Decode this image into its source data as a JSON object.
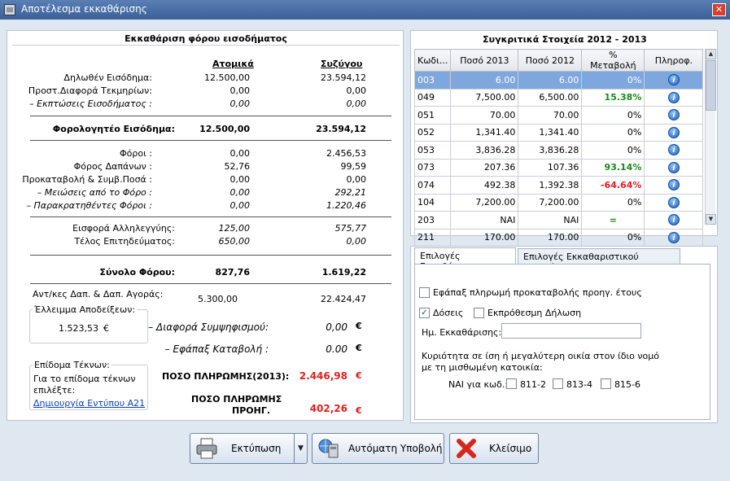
{
  "window": {
    "title": "Αποτέλεσμα εκκαθάρισης"
  },
  "left": {
    "title": "Εκκαθάριση φόρου εισοδήματος",
    "col_individual": "Ατομικά",
    "col_spouse": "Συζύγου",
    "rows": [
      {
        "label": "Δηλωθέν Εισόδημα:",
        "a": "12.500,00",
        "s": "23.594,12"
      },
      {
        "label": "Προστ.Διαφορά Τεκμηρίων:",
        "a": "0,00",
        "s": "0,00"
      },
      {
        "label": "– Εκπτώσεις Εισοδήματος  :",
        "a": "0,00",
        "s": "0,00"
      },
      {
        "label": "Φορολογητέο Εισόδημα:",
        "a": "12.500,00",
        "s": "23.594,12"
      },
      {
        "label": "Φόροι :",
        "a": "0,00",
        "s": "2.456,53"
      },
      {
        "label": "Φόρος Δαπάνων :",
        "a": "52,76",
        "s": "99,59"
      },
      {
        "label": "Προκαταβολή & Συμβ.Ποσά :",
        "a": "0,00",
        "s": "0,00"
      },
      {
        "label": "– Μειώσεις από το Φόρο :",
        "a": "0,00",
        "s": "292,21"
      },
      {
        "label": "– Παρακρατηθέντες Φόροι :",
        "a": "0,00",
        "s": "1.220,46"
      },
      {
        "label": "Εισφορά Αλληλεγγύης:",
        "a": "125,00",
        "s": "575,77"
      },
      {
        "label": "Τέλος Επιτηδεύματος:",
        "a": "650,00",
        "s": "0,00"
      },
      {
        "label": "Σύνολο Φόρου:",
        "a": "827,76",
        "s": "1.619,22"
      },
      {
        "label": "Αντ/κες Δαπ. & Δαπ. Αγοράς:",
        "a": "5.300,00",
        "s": "22.424,47"
      }
    ],
    "receipts_deficit": {
      "label": "Έλλειμμα Αποδείξεων:",
      "value": "1.523,53",
      "currency": "€"
    },
    "offset_diff": {
      "label": "– Διαφορά Συμψηφισμού:",
      "value": "0,00",
      "currency": "€"
    },
    "lump_sum": {
      "label": "– Εφάπαξ Καταβολή :",
      "value": "0.00",
      "currency": "€"
    },
    "payment_2013": {
      "label": "ΠΟΣΟ ΠΛΗΡΩΜΗΣ(2013):",
      "value": "2.446,98",
      "currency": "€"
    },
    "payment_prev": {
      "label_1": "ΠΟΣΟ ΠΛΗΡΩΜΗΣ",
      "label_2": "ΠΡΟΗΓ.",
      "value": "402,26",
      "currency": "€"
    },
    "child_benefit": {
      "legend": "Επίδομα Τέκνων:",
      "text_1": "Για το επίδομα τέκνων",
      "text_2": "επιλέξτε:",
      "link": "Δημιουργία Εντύπου Α21"
    }
  },
  "compare": {
    "title": "Συγκριτικά Στοιχεία  2012 - 2013",
    "headers": [
      "Κωδι...",
      "Ποσό 2013",
      "Ποσό 2012",
      "% Μεταβολή",
      "Πληροφ."
    ],
    "rows": [
      {
        "code": "003",
        "y2013": "6.00",
        "y2012": "6.00",
        "change": "0%",
        "kind": "plain"
      },
      {
        "code": "049",
        "y2013": "7,500.00",
        "y2012": "6,500.00",
        "change": "15.38%",
        "kind": "up"
      },
      {
        "code": "051",
        "y2013": "70.00",
        "y2012": "70.00",
        "change": "0%",
        "kind": "plain"
      },
      {
        "code": "052",
        "y2013": "1,341.40",
        "y2012": "1,341.40",
        "change": "0%",
        "kind": "plain"
      },
      {
        "code": "053",
        "y2013": "3,836.28",
        "y2012": "3,836.28",
        "change": "0%",
        "kind": "plain"
      },
      {
        "code": "073",
        "y2013": "207.36",
        "y2012": "107.36",
        "change": "93.14%",
        "kind": "up"
      },
      {
        "code": "074",
        "y2013": "492.38",
        "y2012": "1,392.38",
        "change": "-64.64%",
        "kind": "down"
      },
      {
        "code": "104",
        "y2013": "7,200.00",
        "y2012": "7,200.00",
        "change": "0%",
        "kind": "plain"
      },
      {
        "code": "203",
        "y2013": "NAI",
        "y2012": "NAI",
        "change": "=",
        "kind": "up"
      },
      {
        "code": "211",
        "y2013": "170.00",
        "y2012": "170.00",
        "change": "0%",
        "kind": "plain"
      }
    ]
  },
  "options": {
    "tab_1": "Επιλογές Εκκαθάρισης",
    "tab_2": "Επιλογές Εκκαθαριστικού Σημειώματος",
    "lump_prepay": {
      "label": "Εφάπαξ πληρωμή προκαταβολής προηγ. έτους",
      "checked": false
    },
    "installments": {
      "label": "Δόσεις",
      "checked": true
    },
    "late": {
      "label": "Εκπρόθεσμη Δήλωση",
      "checked": false
    },
    "date_label": "Ημ. Εκκαθάρισης:",
    "date_value": "",
    "ownership_1": "Κυριότητα σε ίση ή μεγαλύτερη οικία στον ίδιο νομό",
    "ownership_2": "με τη μισθωμένη κατοικία:",
    "nai_label": "ΝΑΙ για κωδ.:",
    "codes": [
      {
        "label": "811-2",
        "checked": false
      },
      {
        "label": "813-4",
        "checked": false
      },
      {
        "label": "815-6",
        "checked": false
      }
    ]
  },
  "buttons": {
    "print": "Εκτύπωση",
    "auto_submit": "Αυτόματη Υποβολή",
    "close": "Κλείσιμο"
  },
  "colors": {
    "accent": "#3b5f97",
    "selected_row": "#7ea7dd",
    "red": "#e01f1f",
    "green": "#1a8a1a"
  }
}
